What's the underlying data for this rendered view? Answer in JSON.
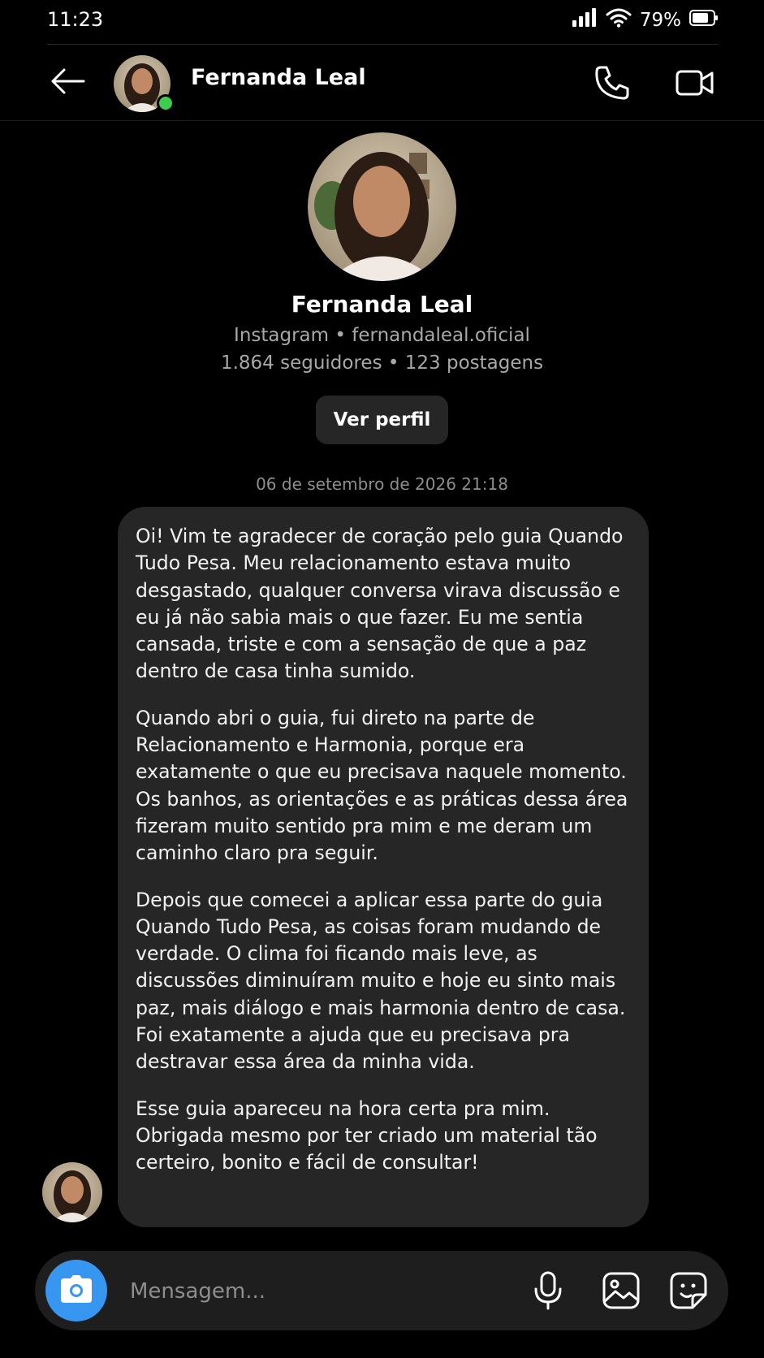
{
  "status_bar": {
    "time": "11:23",
    "battery": "79%",
    "icons": [
      "signal-icon",
      "wifi-icon",
      "battery-icon"
    ]
  },
  "header": {
    "name": "Fernanda Leal",
    "online": true,
    "icons": [
      "back-arrow-icon",
      "phone-icon",
      "video-camera-icon"
    ]
  },
  "profile": {
    "name": "Fernanda Leal",
    "platform": "Instagram",
    "username": "fernandaleal.oficial",
    "followers": "1.864 seguidores",
    "posts": "123 postagens",
    "view_profile_label": "Ver perfil"
  },
  "conversation": {
    "timestamp": "06 de setembro de 2026 21:18",
    "message": {
      "paragraphs": [
        "Oi! Vim te agradecer de coração pelo guia Quando Tudo Pesa. Meu relacionamento estava muito desgastado, qualquer conversa virava discussão e eu já não sabia mais o que fazer. Eu me sentia cansada, triste e com a sensação de que a paz dentro de casa tinha sumido.",
        "Quando abri o guia, fui direto na parte de Relacionamento e Harmonia, porque era exatamente o que eu precisava naquele momento. Os banhos, as orientações e as práticas dessa área fizeram muito sentido pra mim e me deram um caminho claro pra seguir.",
        "Depois que comecei a aplicar essa parte do guia Quando Tudo Pesa, as coisas foram mudando de verdade. O clima foi ficando mais leve, as discussões diminuíram muito e hoje eu sinto mais paz, mais diálogo e mais harmonia dentro de casa. Foi exatamente a ajuda que eu precisava pra destravar essa área da minha vida.",
        "Esse guia apareceu na hora certa pra mim. Obrigada mesmo por ter criado um material tão certeiro, bonito e fácil de consultar!"
      ]
    }
  },
  "composer": {
    "placeholder": "Mensagem...",
    "icons": [
      "camera-icon",
      "microphone-icon",
      "gallery-icon",
      "sticker-icon"
    ]
  },
  "colors": {
    "background": "#000000",
    "bubble": "#262626",
    "accent": "#3797f0",
    "online": "#3ccf4e"
  }
}
